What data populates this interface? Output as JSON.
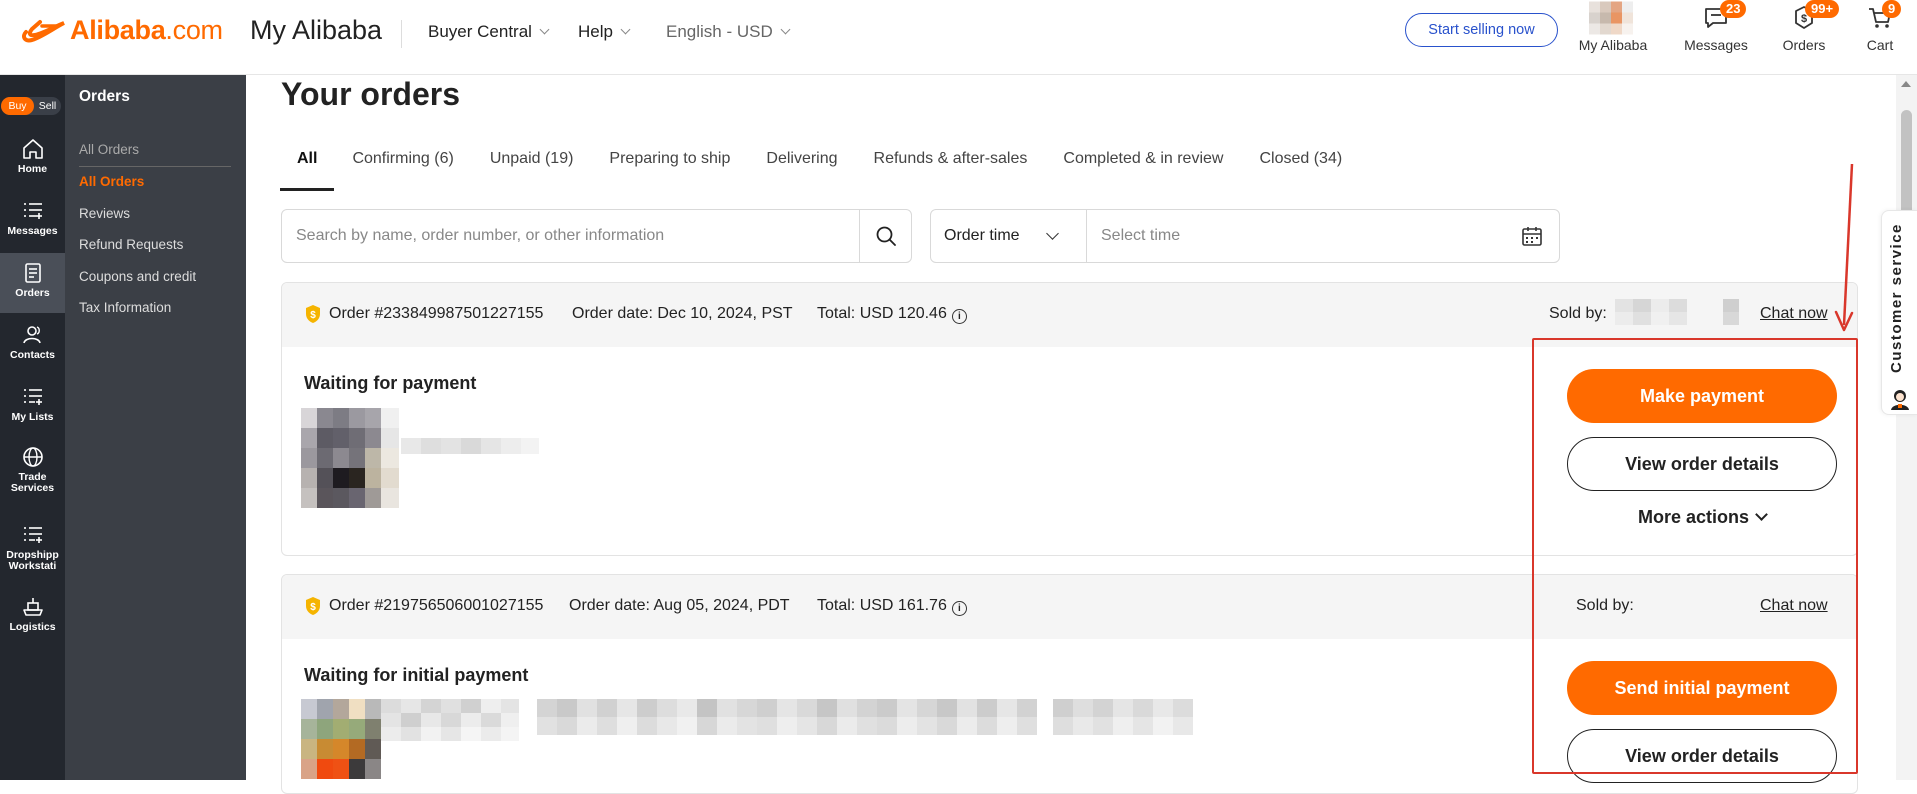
{
  "header": {
    "logo_text": "Alibaba",
    "logo_domain": ".com",
    "site_title": "My Alibaba",
    "menu": [
      {
        "label": "Buyer Central"
      },
      {
        "label": "Help"
      },
      {
        "label": "English - USD"
      }
    ],
    "start_selling": "Start selling now",
    "items": {
      "my_alibaba": {
        "label": "My Alibaba",
        "icon": "avatar"
      },
      "messages": {
        "label": "Messages",
        "badge": "23",
        "icon": "message-icon"
      },
      "orders": {
        "label": "Orders",
        "badge": "99+",
        "icon": "orders-icon"
      },
      "cart": {
        "label": "Cart",
        "badge": "9",
        "icon": "cart-icon"
      }
    },
    "accent_color": "#ff6a00"
  },
  "rail": {
    "buy": "Buy",
    "sell": "Sell",
    "items": [
      {
        "label": "Home",
        "icon": "home-icon"
      },
      {
        "label": "Messages",
        "icon": "list-icon"
      },
      {
        "label": "Orders",
        "icon": "orders-doc-icon",
        "active": true
      },
      {
        "label": "Contacts",
        "icon": "contacts-icon"
      },
      {
        "label": "My Lists",
        "icon": "list-add-icon"
      },
      {
        "label": "Trade Services",
        "label_line1": "Trade",
        "label_line2": "Services",
        "icon": "globe-icon"
      },
      {
        "label": "Dropshipping Workstation",
        "label_line1": "Dropshipp",
        "label_line2": "Workstati",
        "icon": "list-add-icon"
      },
      {
        "label": "Logistics",
        "icon": "ship-icon"
      }
    ]
  },
  "sidebar": {
    "title": "Orders",
    "items": [
      {
        "label": "All Orders",
        "style": "grey"
      },
      {
        "label": "All Orders",
        "style": "active"
      },
      {
        "label": "Reviews"
      },
      {
        "label": "Refund Requests"
      },
      {
        "label": "Coupons and credit"
      },
      {
        "label": "Tax Information"
      }
    ]
  },
  "main": {
    "title": "Your orders",
    "tabs": [
      {
        "label": "All",
        "active": true
      },
      {
        "label": "Confirming (6)"
      },
      {
        "label": "Unpaid (19)"
      },
      {
        "label": "Preparing to ship"
      },
      {
        "label": "Delivering"
      },
      {
        "label": "Refunds & after-sales"
      },
      {
        "label": "Completed & in review"
      },
      {
        "label": "Closed (34)"
      }
    ],
    "search": {
      "placeholder": "Search by name, order number, or other information"
    },
    "time_filter": {
      "selected": "Order time",
      "placeholder": "Select time"
    },
    "orders": [
      {
        "order_no": "Order #233849987501227155",
        "order_date": "Order date: Dec 10, 2024, PST",
        "total": "Total: USD 120.46",
        "sold_by": "Sold by:",
        "chat_now": "Chat now",
        "status": "Waiting for payment",
        "primary_action": "Make payment",
        "secondary_action": "View order details",
        "more_actions": "More actions"
      },
      {
        "order_no": "Order #219756506001027155",
        "order_date": "Order date: Aug 05, 2024, PDT",
        "total": "Total: USD 161.76",
        "sold_by": "Sold by:",
        "chat_now": "Chat now",
        "status": "Waiting for initial payment",
        "primary_action": "Send initial payment",
        "secondary_action": "View order details"
      }
    ]
  },
  "customer_service": {
    "label": "Customer service"
  },
  "annotation_color": "#d9372b"
}
